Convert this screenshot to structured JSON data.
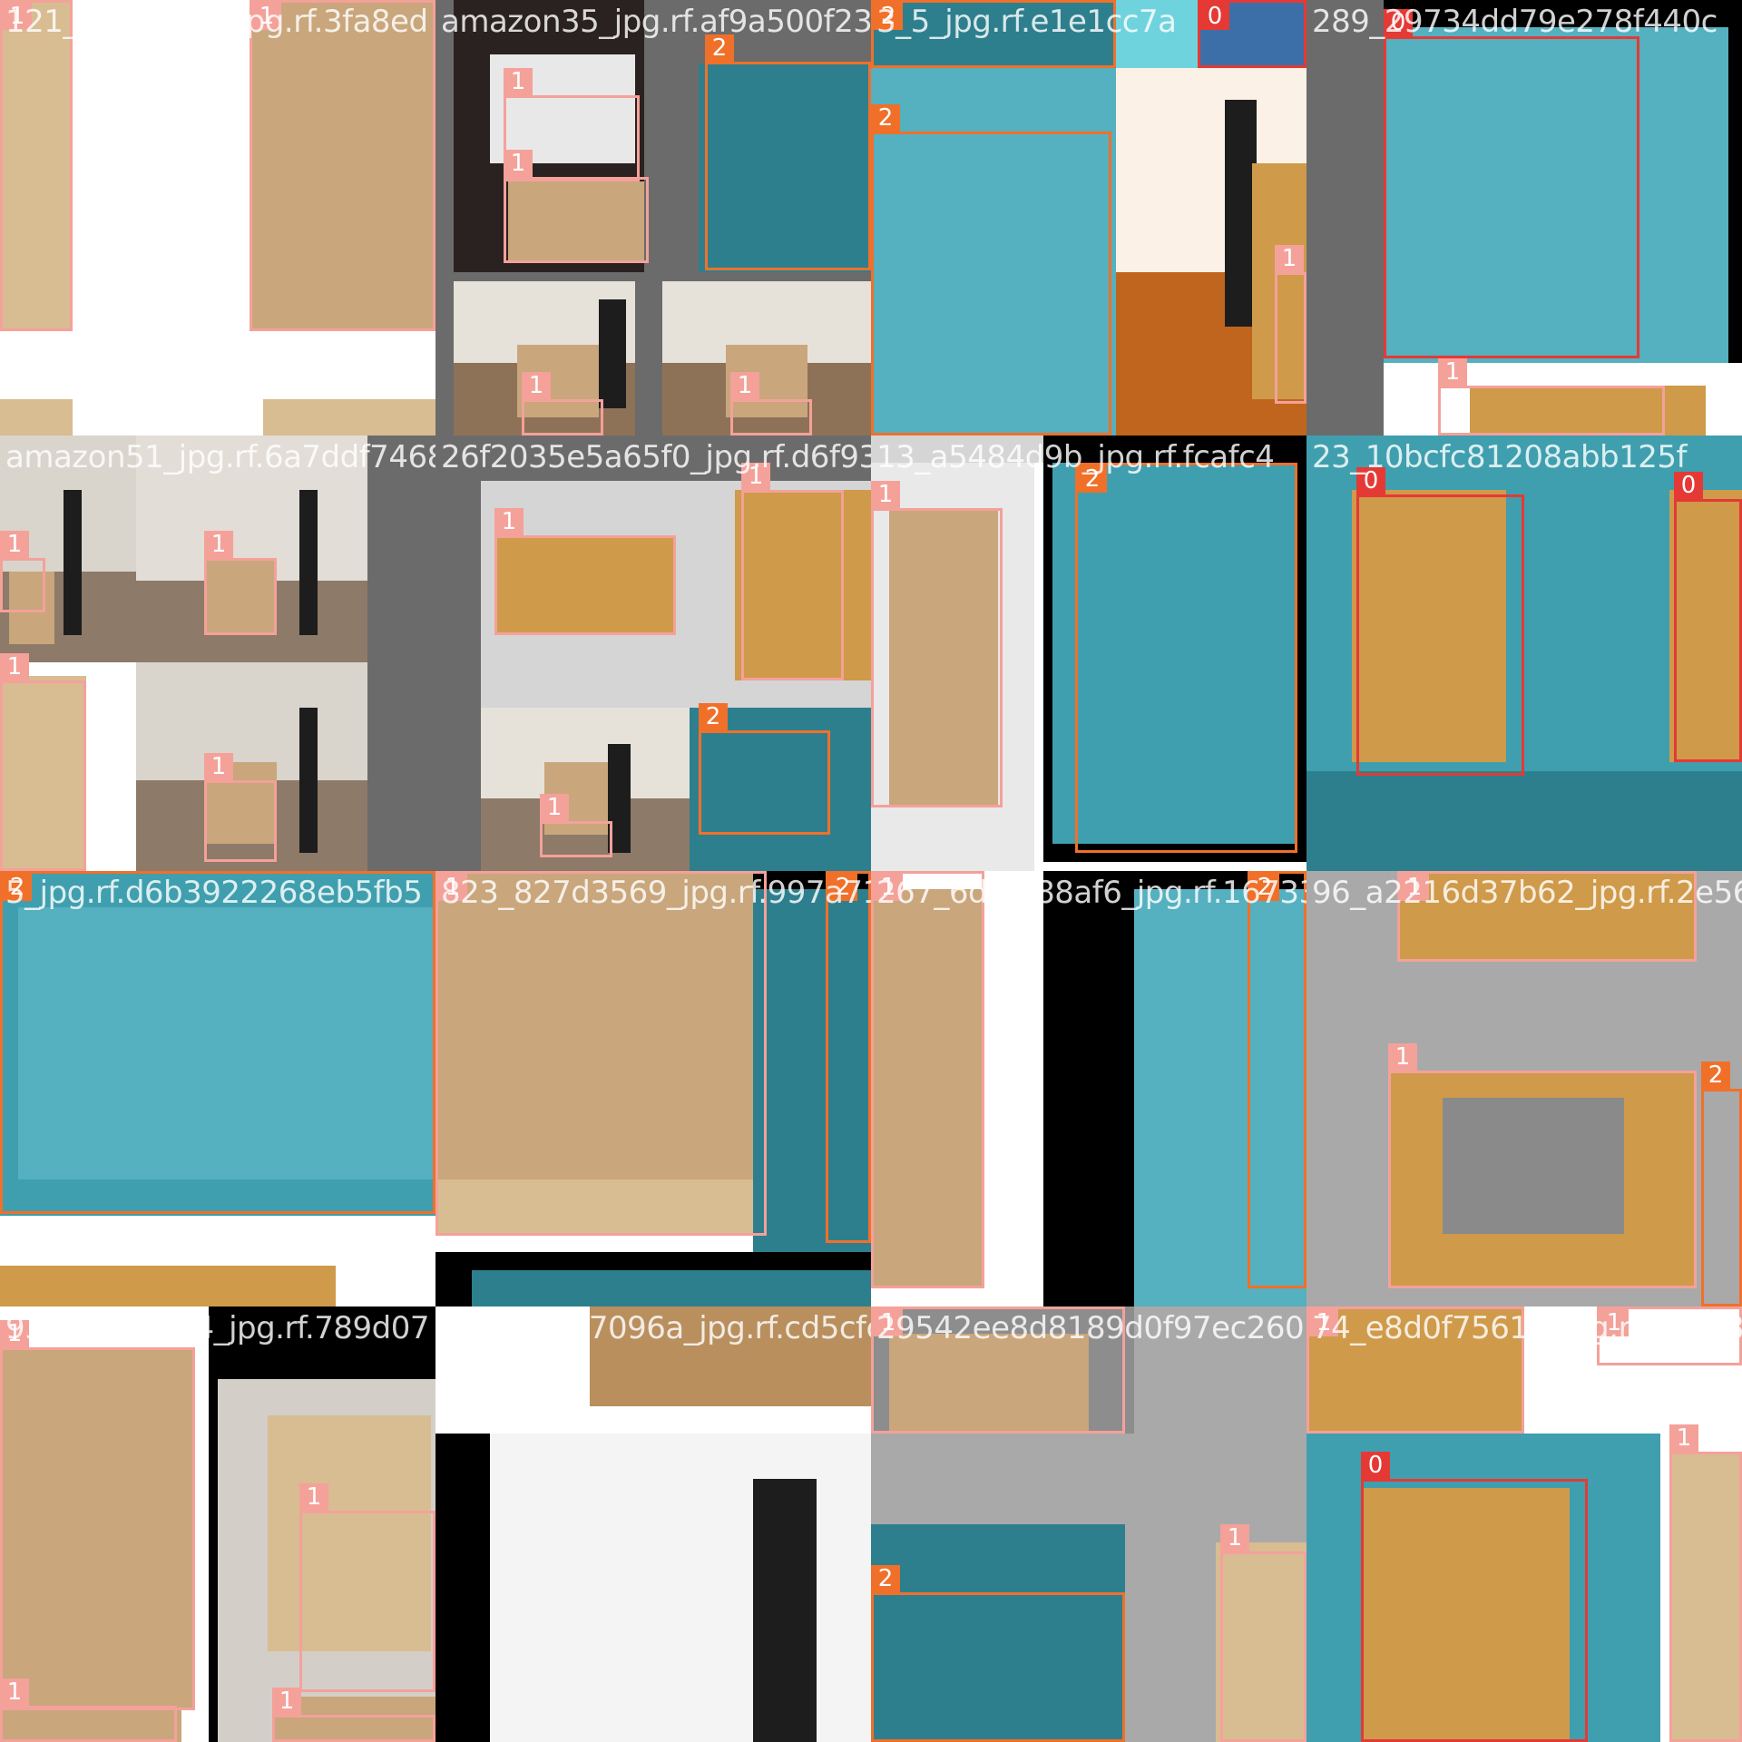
{
  "mosaic": {
    "rows": 4,
    "cols": 4,
    "class_colors": {
      "0": "#e53935",
      "1": "#f4a19a",
      "2": "#f0702a"
    },
    "tiles": [
      {
        "filename": "121_6711229f_jpg.rf.3fa8ed",
        "regions": [],
        "boxes": []
      },
      {
        "filename": "amazon35_jpg.rf.af9a500f23",
        "regions": [],
        "boxes": []
      },
      {
        "filename": "3_5_jpg.rf.e1e1cc7a",
        "regions": [],
        "boxes": []
      },
      {
        "filename": "289_29734dd79e278f440c",
        "regions": [],
        "boxes": []
      },
      {
        "filename": "amazon51_jpg.rf.6a7ddf7468",
        "regions": [],
        "boxes": []
      },
      {
        "filename": "26f2035e5a65f0_jpg.rf.d6f931",
        "regions": [],
        "boxes": []
      },
      {
        "filename": "13_a5484d9b_jpg.rf.fcafc4",
        "regions": [],
        "boxes": []
      },
      {
        "filename": "23_10bcfc81208abb125f",
        "regions": [],
        "boxes": []
      },
      {
        "filename": "5_jpg.rf.d6b3922268eb5fb5",
        "regions": [],
        "boxes": []
      },
      {
        "filename": "823_827d3569_jpg.rf.997a71",
        "regions": [],
        "boxes": []
      },
      {
        "filename": "267_6d0ef88af6_jpg.rf.16733c",
        "regions": [],
        "boxes": []
      },
      {
        "filename": "96_a2216d37b62_jpg.rf.2e562",
        "regions": [],
        "boxes": []
      },
      {
        "filename": "931_03f7bf34_jpg.rf.789d07",
        "regions": [],
        "boxes": []
      },
      {
        "filename": "21_e3a6b7096a_jpg.rf.cd5cfc",
        "regions": [],
        "boxes": []
      },
      {
        "filename": "29542ee8d8189d0f97ec260",
        "regions": [],
        "boxes": []
      },
      {
        "filename": "74_e8d0f75617_jpg.rf.d2628",
        "regions": [],
        "boxes": []
      }
    ]
  }
}
